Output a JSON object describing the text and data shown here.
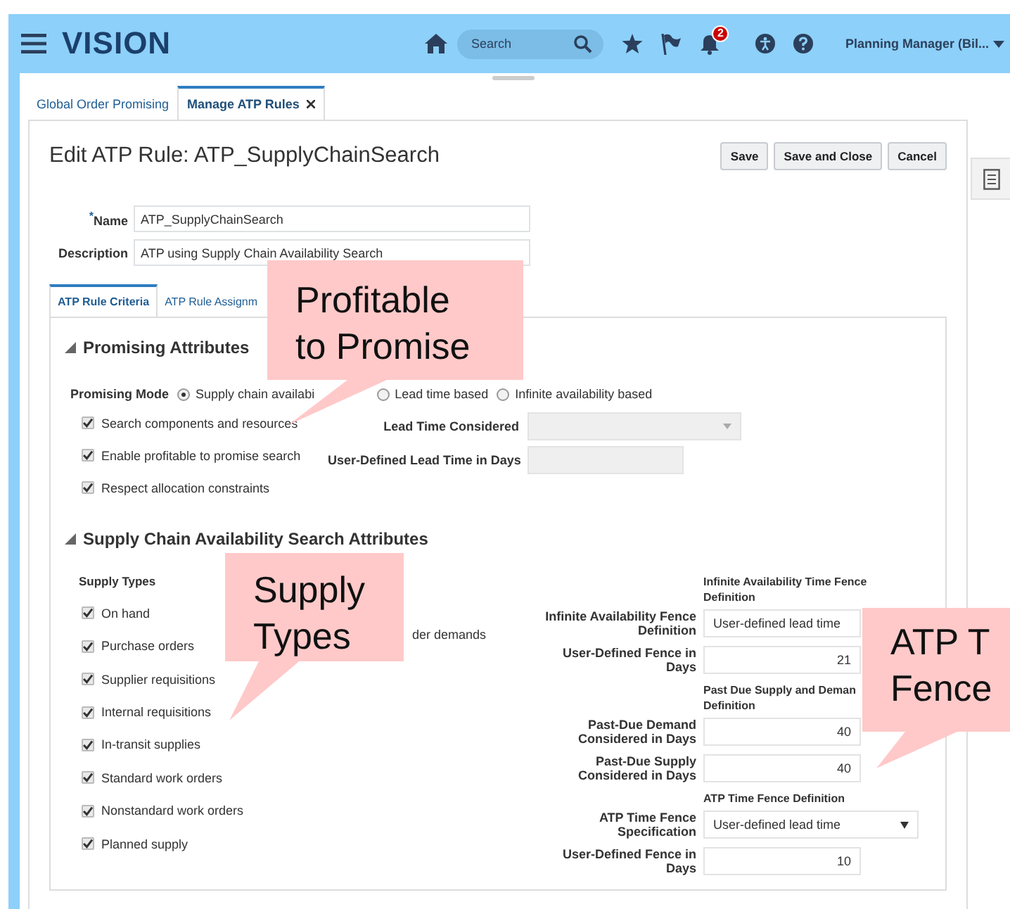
{
  "header": {
    "app_name": "VISION",
    "search": {
      "placeholder": "Search"
    },
    "notification_count": "2",
    "user_menu": "Planning Manager (Bil..."
  },
  "tabs": [
    {
      "label": "Global Order Promising",
      "selected": false,
      "closable": false
    },
    {
      "label": "Manage ATP Rules",
      "selected": true,
      "closable": true
    }
  ],
  "page": {
    "title": "Edit ATP Rule: ATP_SupplyChainSearch",
    "buttons": [
      "Save",
      "Save and Close",
      "Cancel"
    ]
  },
  "fields": [
    {
      "label": "Name",
      "required_mark": "*",
      "value": "ATP_SupplyChainSearch"
    },
    {
      "label": "Description",
      "value": "ATP using Supply Chain Availability Search"
    }
  ],
  "subtabs": [
    {
      "label": "ATP Rule Criteria",
      "selected": true
    },
    {
      "label": "ATP Rule Assignm",
      "selected": false
    }
  ],
  "promising_attributes": {
    "title": "Promising Attributes",
    "expanded": true,
    "mode_label": "Promising Mode",
    "modes": [
      {
        "label": "Supply chain availabi",
        "selected": true
      },
      {
        "label": "Lead time based",
        "selected": false
      },
      {
        "label": "Infinite availability based",
        "selected": false
      }
    ],
    "options": [
      {
        "label": "Search components and resources",
        "checked": true
      },
      {
        "label": "Enable profitable to promise search",
        "checked": true
      },
      {
        "label": "Respect allocation constraints",
        "checked": true
      }
    ],
    "right_fields": [
      {
        "kind": "select",
        "label": "Lead Time Considered",
        "disabled": true
      },
      {
        "kind": "number",
        "label": "User-Defined Lead Time in Days",
        "disabled": true
      }
    ]
  },
  "search_attributes": {
    "title": "Supply Chain Availability Search Attributes",
    "expanded": true,
    "supply_types_label": "Supply Types",
    "supply_types": [
      {
        "label": "On hand",
        "checked": true
      },
      {
        "label": "Purchase orders",
        "checked": true
      },
      {
        "label": "Supplier requisitions",
        "checked": true
      },
      {
        "label": "Internal requisitions",
        "checked": true
      },
      {
        "label": "In-transit supplies",
        "checked": true
      },
      {
        "label": "Standard work orders",
        "checked": true
      },
      {
        "label": "Nonstandard work orders",
        "checked": true
      },
      {
        "label": "Planned supply",
        "checked": true
      }
    ],
    "demand_option_fragment": "der demands",
    "fence_sections": [
      {
        "heading": [
          "Infinite Availability Time Fence",
          "Definition"
        ],
        "fields": [
          {
            "kind": "text",
            "label": "Infinite Availability Fence Definition",
            "value": "User-defined lead time"
          },
          {
            "kind": "number",
            "label": "User-Defined Fence in Days",
            "value": "21"
          }
        ]
      },
      {
        "heading": [
          "Past Due Supply and Deman",
          "Definition"
        ],
        "fields": [
          {
            "kind": "number",
            "label": "Past-Due Demand Considered in Days",
            "value": "40"
          },
          {
            "kind": "number",
            "label": "Past-Due Supply Considered in Days",
            "value": "40"
          }
        ]
      },
      {
        "heading": [
          "ATP Time Fence Definition"
        ],
        "fields": [
          {
            "kind": "select",
            "label": "ATP Time Fence Specification",
            "value": "User-defined lead time"
          },
          {
            "kind": "number",
            "label": "User-Defined Fence in Days",
            "value": "10"
          }
        ]
      }
    ]
  },
  "callouts": [
    {
      "text": "Profitable to Promise"
    },
    {
      "text": "Supply Types"
    },
    {
      "text": "ATP T Fence"
    }
  ]
}
